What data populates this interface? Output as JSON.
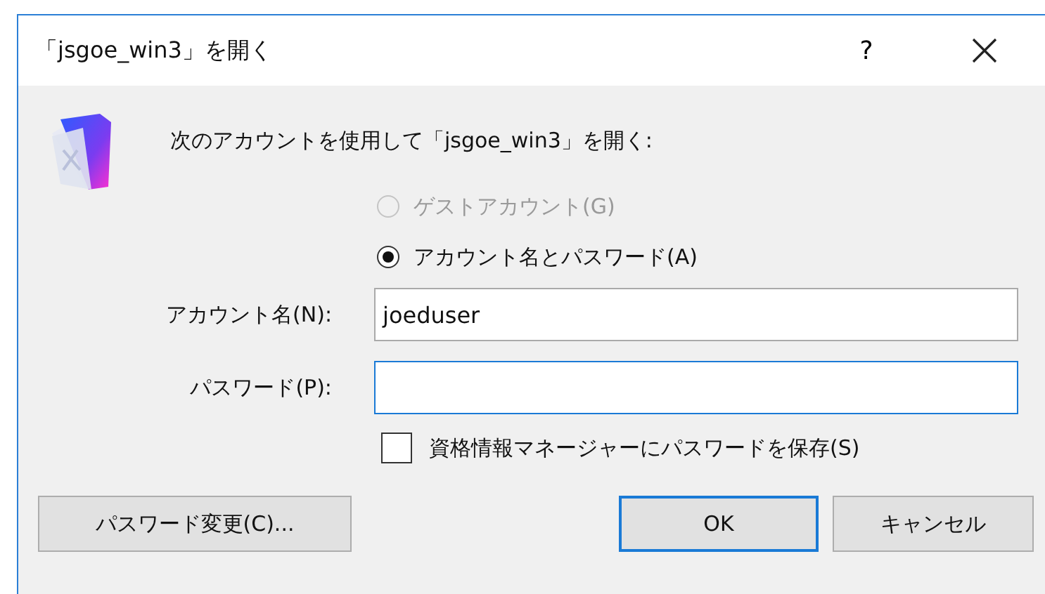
{
  "window": {
    "title": "「jsgoe_win3」を開く",
    "help": "?"
  },
  "prompt": "次のアカウントを使用して「jsgoe_win3」を開く:",
  "radios": [
    {
      "label": "ゲストアカウント(G)",
      "selected": false,
      "disabled": true
    },
    {
      "label": "アカウント名とパスワード(A)",
      "selected": true,
      "disabled": false
    }
  ],
  "fields": [
    {
      "label": "アカウント名(N):",
      "value": "joeduser",
      "focused": false
    },
    {
      "label": "パスワード(P):",
      "focused": true
    }
  ],
  "save_password": {
    "label": "資格情報マネージャーにパスワードを保存(S)",
    "checked": false
  },
  "buttons": [
    {
      "label": "パスワード変更(C)...",
      "default": false
    },
    {
      "label": "OK",
      "default": true
    },
    {
      "label": "キャンセル",
      "default": false
    }
  ]
}
